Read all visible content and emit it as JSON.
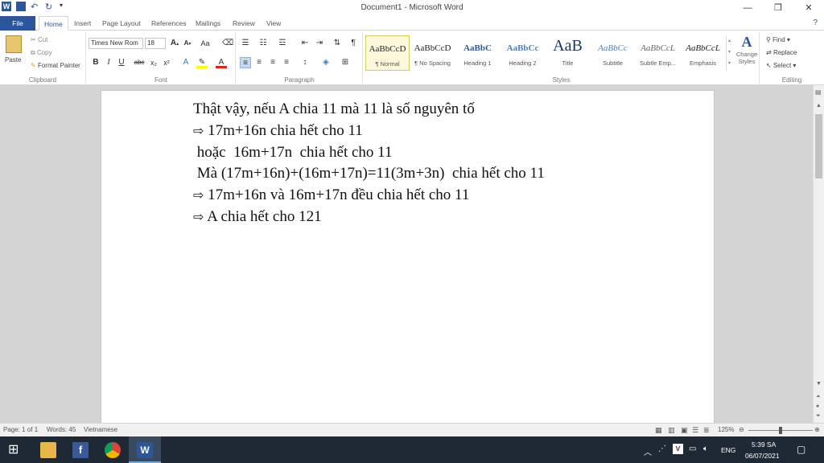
{
  "window": {
    "title": "Document1 - Microsoft Word",
    "minimize": "—",
    "restore": "❐",
    "close": "✕"
  },
  "tabs": [
    "File",
    "Home",
    "Insert",
    "Page Layout",
    "References",
    "Mailings",
    "Review",
    "View"
  ],
  "clipboard": {
    "paste": "Paste",
    "cut": "Cut",
    "copy": "Copy",
    "format_painter": "Format Painter",
    "label": "Clipboard"
  },
  "font": {
    "family": "Times New Rom",
    "size": "18",
    "label": "Font"
  },
  "paragraph": {
    "label": "Paragraph"
  },
  "styles": {
    "label": "Styles",
    "items": [
      {
        "sample": "AaBbCcD",
        "name": "¶ Normal"
      },
      {
        "sample": "AaBbCcD",
        "name": "¶ No Spacing"
      },
      {
        "sample": "AaBbC",
        "name": "Heading 1"
      },
      {
        "sample": "AaBbCc",
        "name": "Heading 2"
      },
      {
        "sample": "AaB",
        "name": "Title"
      },
      {
        "sample": "AaBbCc",
        "name": "Subtitle"
      },
      {
        "sample": "AaBbCcL",
        "name": "Subtle Emp..."
      },
      {
        "sample": "AaBbCcL",
        "name": "Emphasis"
      }
    ],
    "change_styles": "Change Styles"
  },
  "editing": {
    "find": "Find",
    "replace": "Replace",
    "select": "Select",
    "label": "Editing"
  },
  "document": {
    "lines": [
      "Thật vậy, nếu A chia 11 mà 11 là số nguyên tố",
      "17m+16n chia hết cho 11",
      " hoặc  16m+17n  chia hết cho 11",
      " Mà (17m+16n)+(16m+17n)=11(3m+3n)  chia hết cho 11",
      "17m+16n và 16m+17n đều chia hết cho 11",
      "A chia hết cho 121"
    ],
    "arrow": "⇨"
  },
  "status": {
    "page": "Page: 1 of 1",
    "words": "Words: 45",
    "language": "Vietnamese",
    "zoom": "125%"
  },
  "taskbar": {
    "lang": "ENG",
    "time": "5:39 SA",
    "date": "06/07/2021"
  }
}
